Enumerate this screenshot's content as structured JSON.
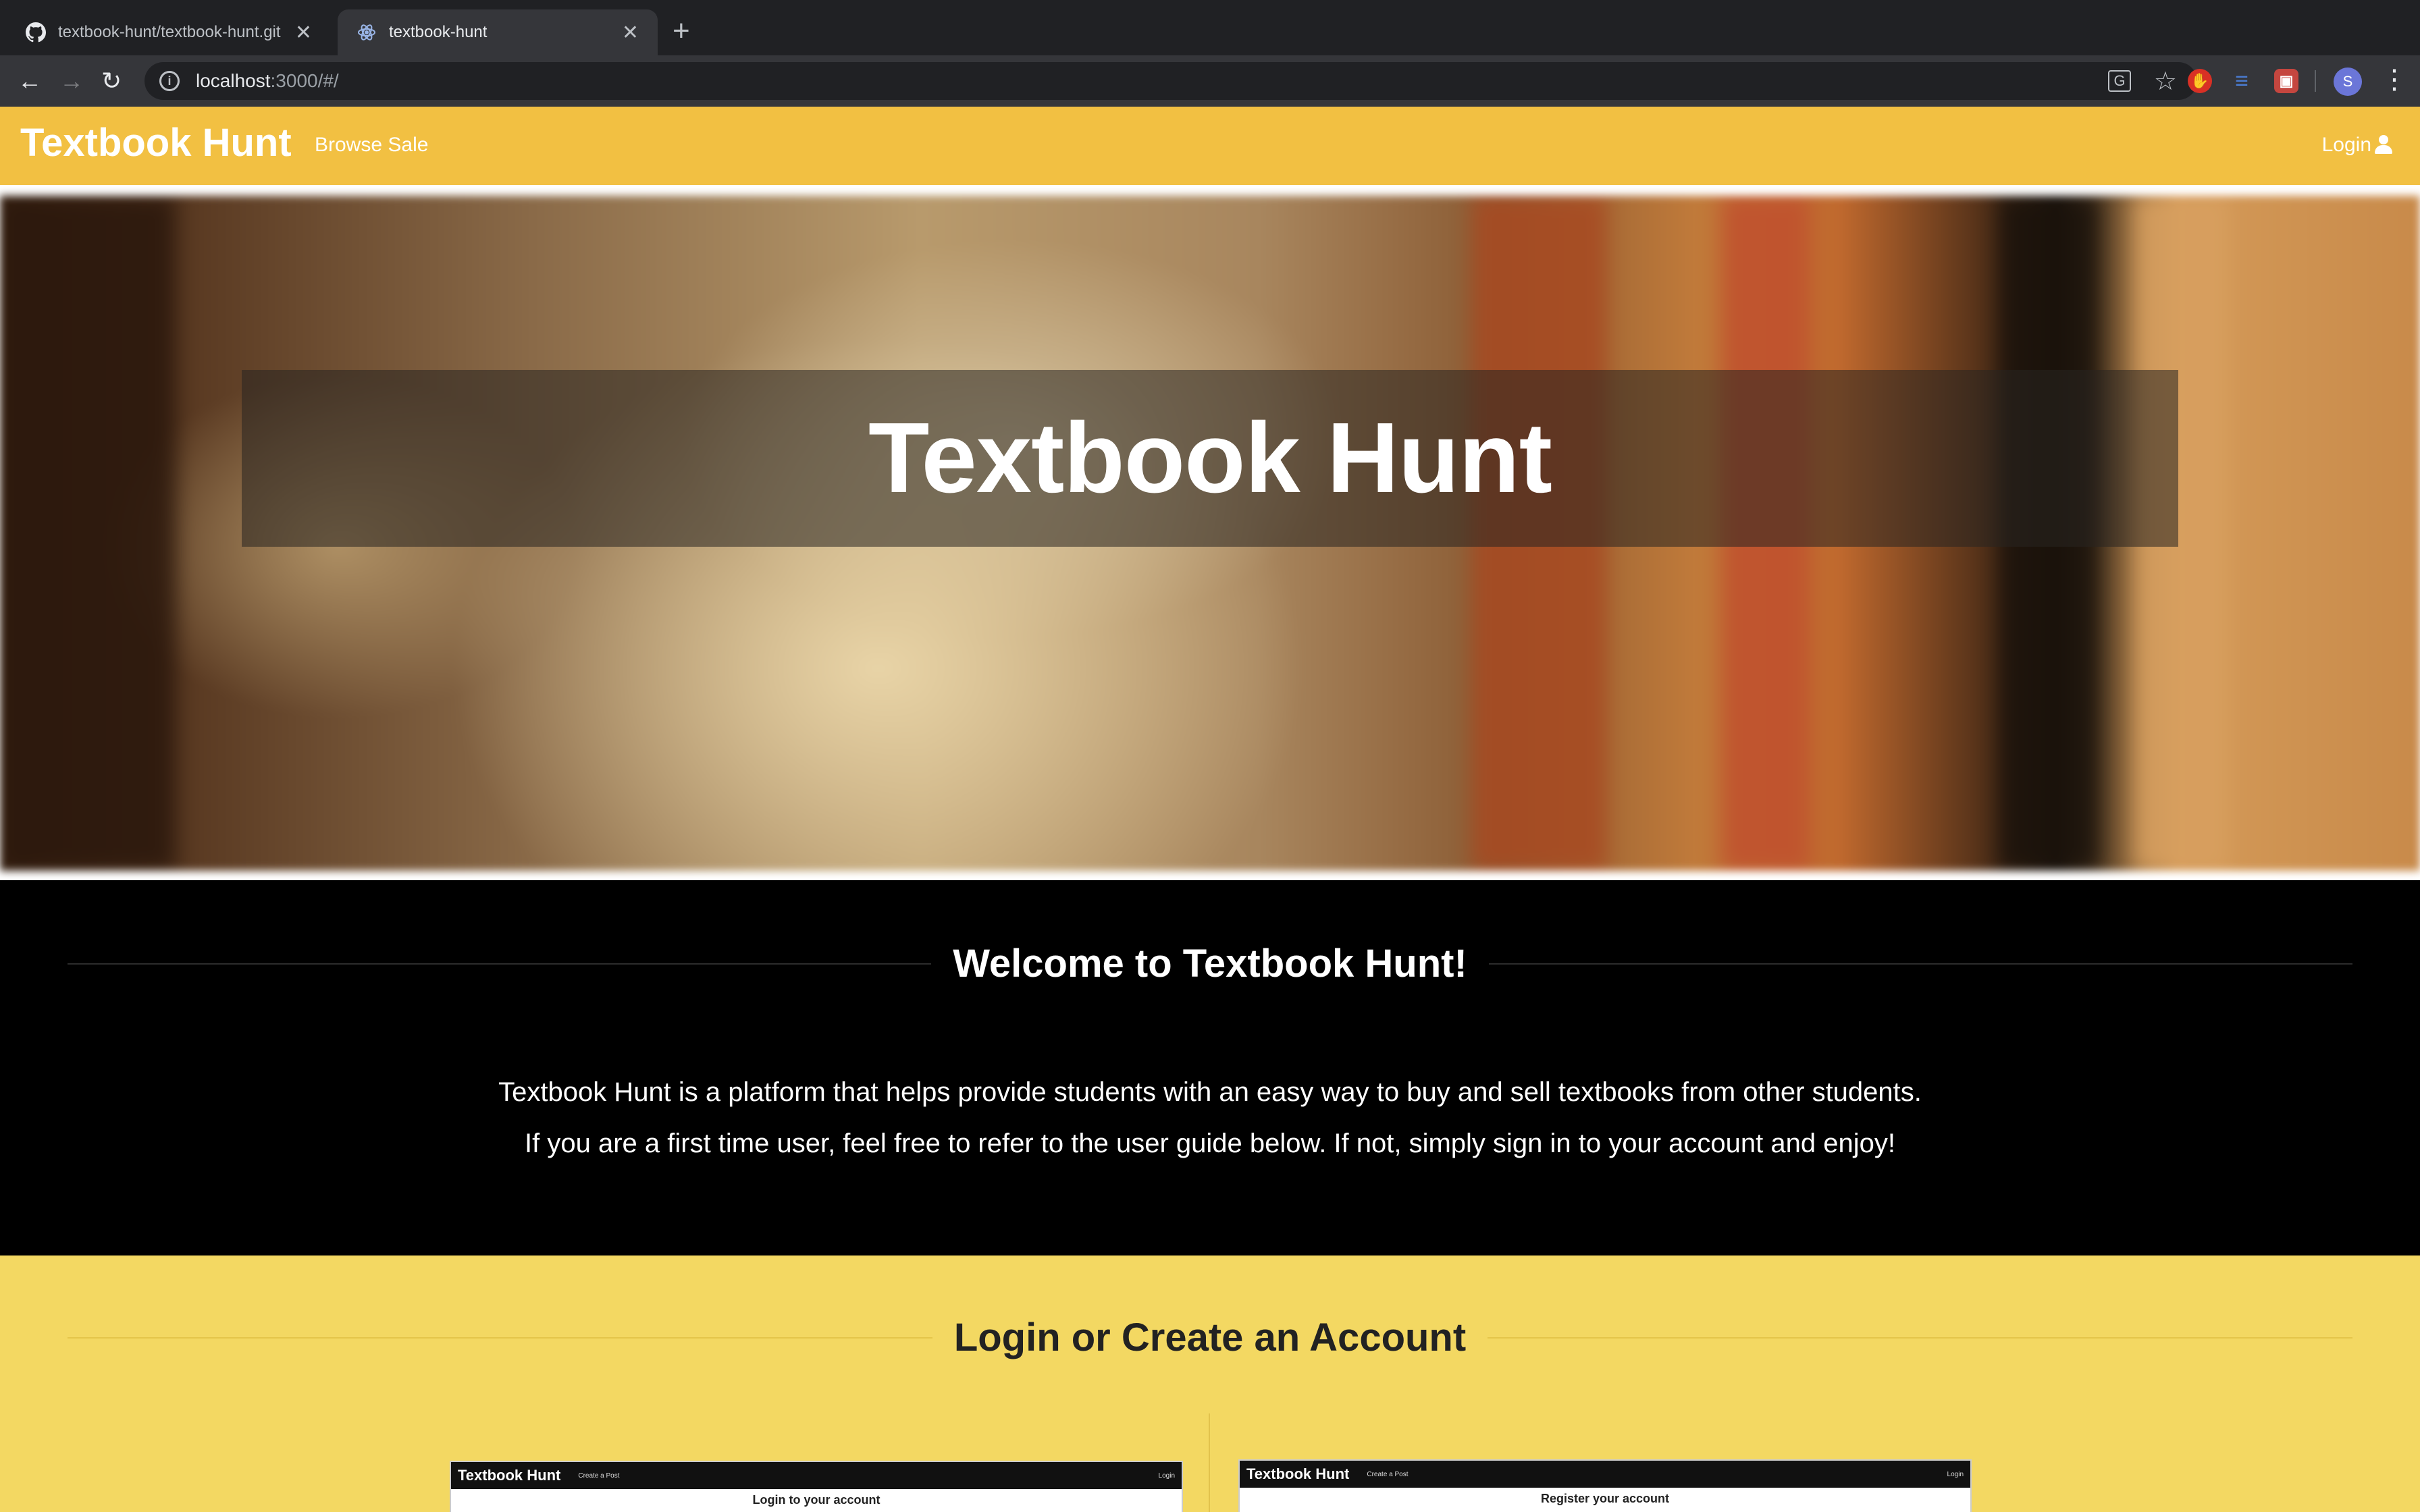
{
  "browser": {
    "tabs": [
      {
        "title": "textbook-hunt/textbook-hunt.git",
        "icon": "github-icon",
        "active": false
      },
      {
        "title": "textbook-hunt",
        "icon": "react-icon",
        "active": true
      }
    ],
    "new_tab_symbol": "+",
    "url_host": "localhost",
    "url_path": ":3000/#/",
    "profile_initial": "S"
  },
  "navbar": {
    "brand": "Textbook Hunt",
    "browse_label": "Browse Sale",
    "login_label": "Login",
    "background": "#f2c042"
  },
  "hero": {
    "title": "Textbook Hunt"
  },
  "welcome": {
    "heading": "Welcome to Textbook Hunt!",
    "line1": "Textbook Hunt is a platform that helps provide students with an easy way to buy and sell textbooks from other students.",
    "line2": "If you are a first time user, feel free to refer to the user guide below. If not, simply sign in to your account and enjoy!"
  },
  "account": {
    "heading": "Login or Create an Account",
    "background": "#f3d862",
    "screenshots": [
      {
        "brand": "Textbook Hunt",
        "link": "Create a Post",
        "login": "Login",
        "title": "Login to your account"
      },
      {
        "brand": "Textbook Hunt",
        "link": "Create a Post",
        "login": "Login",
        "title": "Register your account"
      }
    ]
  }
}
